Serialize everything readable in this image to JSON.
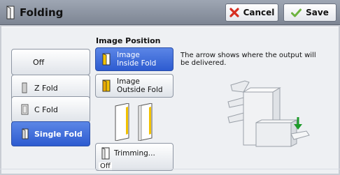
{
  "header": {
    "title": "Folding",
    "cancel_label": "Cancel",
    "save_label": "Save"
  },
  "fold_options": [
    {
      "label": "Off",
      "selected": false,
      "icon": "none"
    },
    {
      "label": "Z Fold",
      "selected": false,
      "icon": "z-fold-icon"
    },
    {
      "label": "C Fold",
      "selected": false,
      "icon": "c-fold-icon"
    },
    {
      "label": "Single Fold",
      "selected": true,
      "icon": "single-fold-icon"
    }
  ],
  "image_position": {
    "title": "Image Position",
    "inside": {
      "line1": "Image",
      "line2": "Inside Fold",
      "selected": true
    },
    "outside": {
      "line1": "Image",
      "line2": "Outside Fold",
      "selected": false
    }
  },
  "description": "The arrow shows where the output will be delivered.",
  "trimming": {
    "label": "Trimming...",
    "value": "Off"
  },
  "colors": {
    "selected_blue": "#2d5bd0",
    "accent_yellow": "#f2c200",
    "cancel_red": "#d62d20",
    "save_green": "#6db33f",
    "output_arrow_green": "#1e9a2a"
  }
}
